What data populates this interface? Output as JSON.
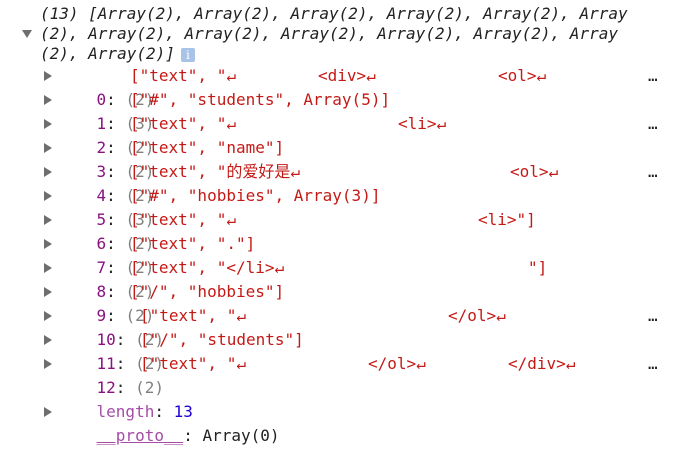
{
  "header": {
    "line1": "(13) [Array(2), Array(2), Array(2), Array(2), Array(2), Array",
    "line2": "(2), Array(2), Array(2), Array(2), Array(2), Array(2), Array",
    "line3": "(2), Array(2)]",
    "info_glyph": "i"
  },
  "rows": [
    {
      "index": "0",
      "count": "(2)",
      "parts": [
        "[\"text\", \"↵",
        "<div>↵",
        "<ol>↵"
      ],
      "ellipsis": "…"
    },
    {
      "index": "1",
      "count": "(3)",
      "text": "[\"#\", \"students\", Array(5)]"
    },
    {
      "index": "2",
      "count": "(2)",
      "parts": [
        "[\"text\", \"↵",
        "<li>↵"
      ],
      "ellipsis": "…"
    },
    {
      "index": "3",
      "count": "(2)",
      "text": "[\"text\", \"name\"]"
    },
    {
      "index": "4",
      "count": "(2)",
      "parts": [
        "[\"text\", \"的爱好是↵",
        "<ol>↵"
      ],
      "ellipsis": "…"
    },
    {
      "index": "5",
      "count": "(3)",
      "text": "[\"#\", \"hobbies\", Array(3)]"
    },
    {
      "index": "6",
      "count": "(2)",
      "parts": [
        "[\"text\", \"↵",
        "<li>\"]"
      ]
    },
    {
      "index": "7",
      "count": "(2)",
      "text": "[\"text\", \".\"]"
    },
    {
      "index": "8",
      "count": "(2)",
      "parts": [
        "[\"text\", \"</li>↵",
        "\"]"
      ]
    },
    {
      "index": "9",
      "count": "(2)",
      "text": "[\"/\", \"hobbies\"]"
    },
    {
      "index": "10",
      "count": "(2)",
      "parts": [
        "[\"text\", \"↵",
        "</ol>↵"
      ],
      "ellipsis": "…"
    },
    {
      "index": "11",
      "count": "(2)",
      "text": "[\"/\", \"students\"]"
    },
    {
      "index": "12",
      "count": "(2)",
      "parts": [
        "[\"text\", \"↵",
        "</ol>↵",
        "</div>↵"
      ],
      "ellipsis": "…"
    }
  ],
  "length_label": "length",
  "length_value": "13",
  "proto_label": "__proto__",
  "proto_value": "Array(0)"
}
